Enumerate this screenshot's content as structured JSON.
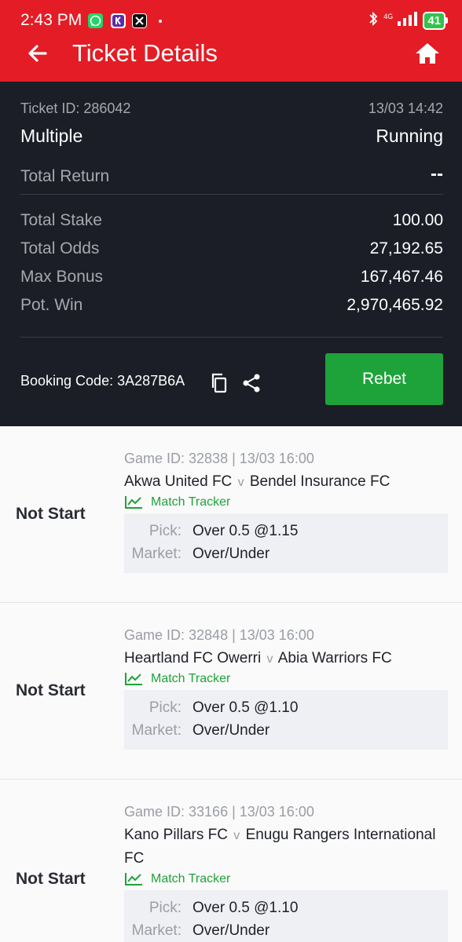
{
  "status_bar": {
    "time": "2:43 PM",
    "network": "4G",
    "battery": "41",
    "notification_icons": [
      "whatsapp-icon",
      "k-app-icon",
      "x-icon"
    ]
  },
  "header": {
    "title": "Ticket Details"
  },
  "ticket": {
    "id_label": "Ticket ID: 286042",
    "datetime": "13/03 14:42",
    "type": "Multiple",
    "status": "Running",
    "total_return_label": "Total Return",
    "total_return_value": "--",
    "stats": [
      {
        "label": "Total Stake",
        "value": "100.00"
      },
      {
        "label": "Total Odds",
        "value": "27,192.65"
      },
      {
        "label": "Max Bonus",
        "value": "167,467.46"
      },
      {
        "label": "Pot. Win",
        "value": "2,970,465.92"
      }
    ],
    "booking_code_label": "Booking Code: 3A287B6A",
    "rebet_label": "Rebet"
  },
  "matches": [
    {
      "status": "Not Start",
      "game_id": "Game ID: 32838 | 13/03 16:00",
      "home": "Akwa United FC",
      "away": "Bendel Insurance FC",
      "vs": "v",
      "tracker": "Match Tracker",
      "pick_label": "Pick:",
      "pick": "Over 0.5 @1.15",
      "market_label": "Market:",
      "market": "Over/Under"
    },
    {
      "status": "Not Start",
      "game_id": "Game ID: 32848 | 13/03 16:00",
      "home": "Heartland FC Owerri",
      "away": "Abia Warriors FC",
      "vs": "v",
      "tracker": "Match Tracker",
      "pick_label": "Pick:",
      "pick": "Over 0.5 @1.10",
      "market_label": "Market:",
      "market": "Over/Under"
    },
    {
      "status": "Not Start",
      "game_id": "Game ID: 33166 | 13/03 16:00",
      "home": "Kano Pillars FC",
      "away": "Enugu Rangers International FC",
      "vs": "v",
      "tracker": "Match Tracker",
      "pick_label": "Pick:",
      "pick": "Over 0.5 @1.10",
      "market_label": "Market:",
      "market": "Over/Under"
    }
  ],
  "colors": {
    "header_red": "#e41c25",
    "card_dark": "#1b1e26",
    "accent_green": "#1ea33a"
  }
}
